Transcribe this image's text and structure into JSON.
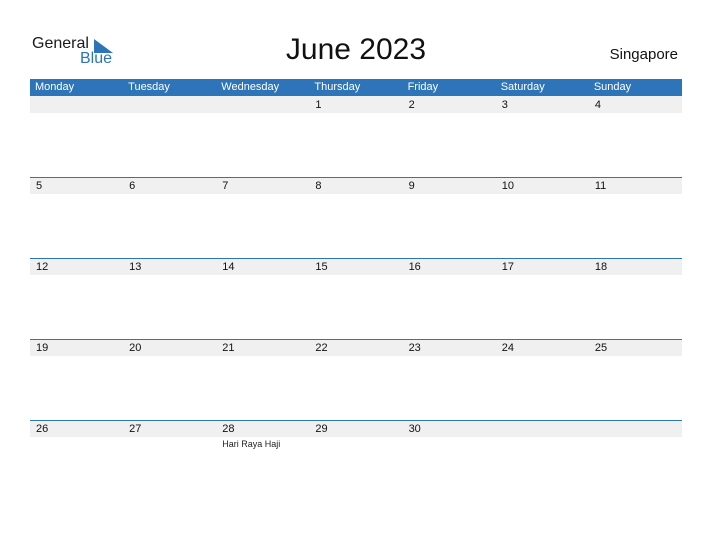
{
  "brand": {
    "line1": "General",
    "line2": "Blue",
    "accent": "#2d74b9"
  },
  "title": "June 2023",
  "country": "Singapore",
  "weekdays": [
    "Monday",
    "Tuesday",
    "Wednesday",
    "Thursday",
    "Friday",
    "Saturday",
    "Sunday"
  ],
  "weeks": [
    [
      {
        "d": ""
      },
      {
        "d": ""
      },
      {
        "d": ""
      },
      {
        "d": "1"
      },
      {
        "d": "2"
      },
      {
        "d": "3"
      },
      {
        "d": "4"
      }
    ],
    [
      {
        "d": "5"
      },
      {
        "d": "6"
      },
      {
        "d": "7"
      },
      {
        "d": "8"
      },
      {
        "d": "9"
      },
      {
        "d": "10"
      },
      {
        "d": "11"
      }
    ],
    [
      {
        "d": "12"
      },
      {
        "d": "13"
      },
      {
        "d": "14"
      },
      {
        "d": "15"
      },
      {
        "d": "16"
      },
      {
        "d": "17"
      },
      {
        "d": "18"
      }
    ],
    [
      {
        "d": "19"
      },
      {
        "d": "20"
      },
      {
        "d": "21"
      },
      {
        "d": "22"
      },
      {
        "d": "23"
      },
      {
        "d": "24"
      },
      {
        "d": "25"
      }
    ],
    [
      {
        "d": "26"
      },
      {
        "d": "27"
      },
      {
        "d": "28",
        "event": "Hari Raya Haji"
      },
      {
        "d": "29"
      },
      {
        "d": "30"
      },
      {
        "d": ""
      },
      {
        "d": ""
      }
    ]
  ]
}
